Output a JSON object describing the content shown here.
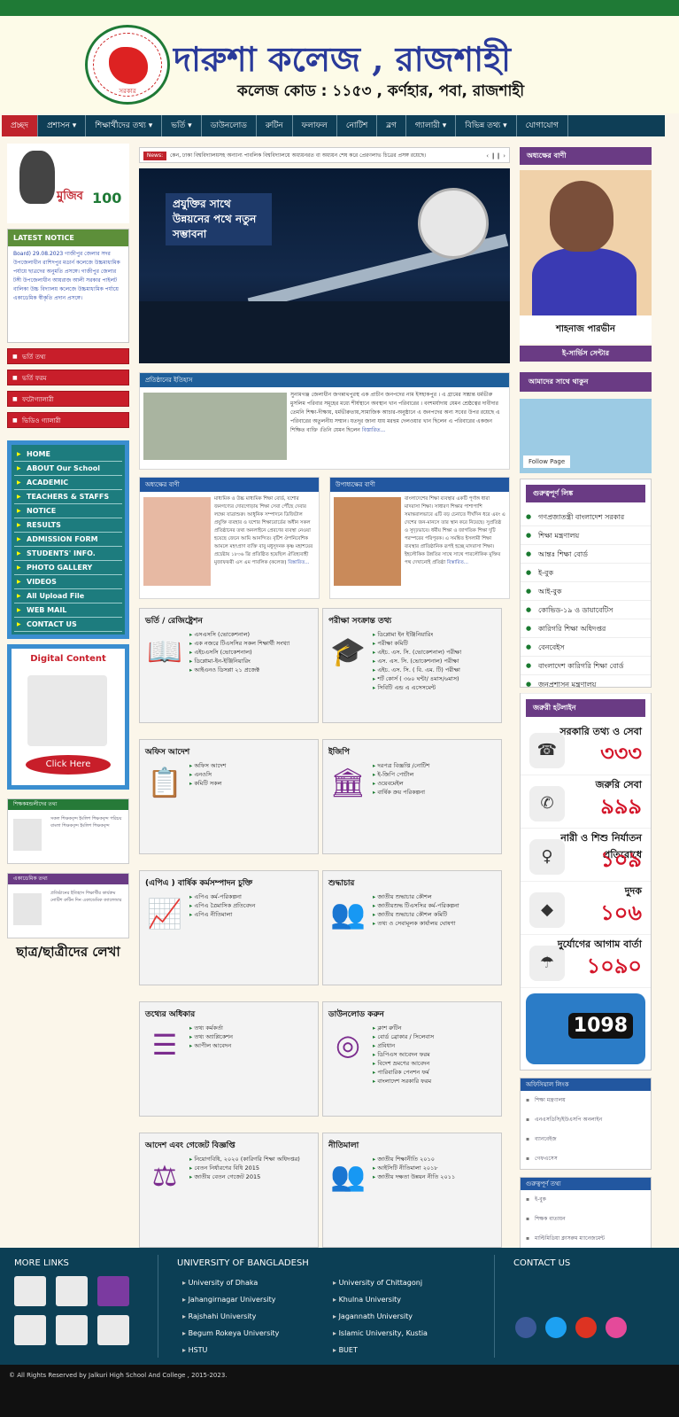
{
  "header": {
    "title": "দারুশা কলেজ , রাজশাহী",
    "subtitle": "কলেজ কোড : ১১৫৩ , কর্ণহার, পবা, রাজশাহী",
    "seal_text": "সরকার"
  },
  "nav": [
    "প্রচ্ছদ",
    "প্রশাসন ▾",
    "শিক্ষার্থীদের তথ্য ▾",
    "ভর্তি ▾",
    "ডাউনলোড",
    "রুটিন",
    "ফলাফল",
    "নোটিশ",
    "ব্লগ",
    "গ্যালারী ▾",
    "বিভিন্ন তথ্য ▾",
    "যোগাযোগ"
  ],
  "left": {
    "mujib_title": "মুজিব",
    "mujib_num": "100",
    "latest_notice_title": "LATEST NOTICE",
    "notice_text": "Board) 29.08.2023 গাজীপুর জেলার সদর উপজেলাধীন রাশিদপুর মডার্ন কলেজে উচ্চমাধ্যমিক পর্যায়ে ছাত্রদের অনুমতি প্রসঙ্গে। গাজীপুর জেলার টঙ্গী উপজেলাধীন আয়রাজ আলী সরকার পাইলট বালিকা উচ্চ বিদ্যালয় কলেজে উচ্চমাধ্যমিক পর্যায়ে একাডেমিক স্বীকৃতি প্রদান প্রসঙ্গে।",
    "red_buttons": [
      "ভর্তি তথ্য",
      "ভর্তি ফরম",
      "ফটোগ্যালারী",
      "ভিডিও গ্যালারী"
    ],
    "menu": [
      "HOME",
      "ABOUT Our School",
      "ACADEMIC",
      "TEACHERS & STAFFS",
      "NOTICE",
      "RESULTS",
      "ADMISSION FORM",
      "STUDENTS' INFO.",
      "PHOTO GALLERY",
      "VIDEOS",
      "All Upload File",
      "WEB MAIL",
      "CONTACT US"
    ],
    "digital_content_title": "Digital Content",
    "click_here": "Click Here",
    "teacher_widget_title": "শিক্ষকমন্ডলীদের তথ্য",
    "teacher_widget_items": "সকল শিক্ষকবৃন্দ ইংলিশ শিক্ষকবৃন্দ পরিচয় বাংলা শিক্ষকবৃন্দ ইংলিশ শিক্ষকবৃন্দ",
    "academic_widget_title": "একাডেমিক তথ্য",
    "academic_widget_items": "প্রতিষ্ঠানের ইতিহাস শিক্ষার্থীর কার্যক্রম নোটিশ রুটিন দিন একাডেমিক ক্যালেন্ডার",
    "students_writing": "ছাত্র/ছাত্রীদের লেখা"
  },
  "middle": {
    "news_label": "News:",
    "news_text": "কেন, ঢাকা বিশ্ববিদ্যালয়সহ অন্যান্য পাবলিক বিশ্ববিদ্যালয়ে অধ্যয়নরত বা অধ্যয়ন শেষ করে প্রেরণলাভ চিত্রের প্রসঙ্গ রয়েছে।",
    "news_controls": "‹ ❙❙ ›",
    "slider_caption": "প্রযুক্তির সাথে উন্নয়নের পথে নতুন সম্ভাবনা",
    "history_title": "প্রতিষ্ঠানের ইতিহাস",
    "history_text": "সুনামগঞ্জ জেলাধীন জগন্নাথপুরস্থ এক প্রাচীন জনপদের নাম ইসহাকপুর । এ গ্রামের সম্ভ্রান্ত ধর্মভীরু মুসলিম পরিবার সমূহের মধ্যে শীর্ষস্থানে অবস্থান খান পরিবারের । বংশমর্যাদায় যেমন শ্রেষ্ঠত্বের দাবীদার তেমনি শিক্ষা-দীক্ষায়, ধর্মভীরুতায়,সামাজিক আচার-অনুষ্ঠানে এ জনপদের অন্য সবের উপর রয়েছে এ পরিবারের অতুলনীয় সম্মান। যতদূর জানা যায় মরহুম দেলওয়ার খান ছিলেন এ পরিবারের একজন শিক্ষিত ব্যক্তি ।তিনি যেমন ছিলেন",
    "read_more": "বিস্তারিত...",
    "principal_title": "অধ্যক্ষের বাণী",
    "principal_text": "মাধ্যমিক ও উচ্চ মাধ্যমিক শিক্ষা বোর্ড, যশোর জনগণ্যের দোরগোড়ায় শিক্ষা সেবা পৌঁছে দেবার লক্ষ্যে যাত্রাশুরু। আধুনিক সম্পাদনে ডিজিটাল প্রযুক্তি ব্যবহার ও যশোর শিক্ষাবোর্ডের অধীন সকল প্রতিষ্ঠানের তথ্য অনলাইনে প্রেরণের ব্যবস্থা নেওয়া হয়েছে জেনে আমি আনন্দিত। বৃটিশ ঔপনিবেশিক আমলে মহৎপ্রাণ ব্যক্তি বাবু মধুসূদনক কৃষ্ণ মহাশয়ের প্রচেষ্টায় ১৮৩৬ খ্রি প্রতিষ্ঠিত হয়েছিল ঐতিহ্যবাহী মুজাফফরী এস এম পাবলিক (কলেজ)",
    "vice_title": "উপাধ্যক্ষের বাণী",
    "vice_text": "বাংলাদেশের শিক্ষা ব্যবস্থার একটি পূর্ণাঙ্গ ধারা মাদরাসা শিক্ষা। সাধারণ শিক্ষার পাশাপাশি সমান্তরালভাবে এটি বড় চেনাতে দীর্ঘদিন ধরে এবং এ দেশের জন-মানসে তার স্থান করে নিয়েছে। সুপ্রতিষ্ঠ ও সুদৃঢ়ভাবে। ধর্মীয় শিক্ষা ও জাগতিক শিক্ষা দুটি পরস্পরের পরিপূরক। এ সমন্বিত ইসলামী শিক্ষা ব্যবস্থার প্রাতিষ্ঠানিক রূপই হচ্ছে মাদরাসা শিক্ষা। ইহলৌকিক উন্নতির সাথে সাথে পারলৌকিক মুক্তির পথ দেখানোই প্রতিষ্ঠা",
    "boxes": [
      {
        "title": "ভর্তি / রেজিষ্ট্রেশন",
        "icon": "book-icon",
        "glyph": "📖",
        "items": [
          "এসএসসি (ভোকেশনাল)",
          "এক নজরে টিএসসির সকল শিক্ষার্থী সংখ্যা",
          "এইচএসসি (ভোকেশনাল)",
          "ডিপ্লোমা-ইন-ইঞ্জিনিয়ারিং",
          "আইএনও ডিসপ্লা ২১ প্রজেক্ট"
        ]
      },
      {
        "title": "পরীক্ষা সংক্রান্ত তথ্য",
        "icon": "graduate-icon",
        "glyph": "🎓",
        "items": [
          "ডিপ্লোমা ইন ইঞ্জিনিয়ারিং",
          "পরীক্ষা কমিটি",
          "এইচ. এস. সি. (ভোকেশনাল) পরীক্ষা",
          "এস. এস. সি. (ভোকেশনাল) পরীক্ষা",
          "এইচ. এস. সি. ( বি. এম. টি) পরীক্ষা",
          "শর্ট কোর্স ( ৩৬০ ঘন্টা/ ৪মাস/৬মাস)",
          "সিবিটি এন্ড এ এসেসমেন্ট"
        ]
      },
      {
        "title": "অফিস আদেশ",
        "icon": "clipboard-icon",
        "glyph": "📋",
        "items": [
          "অফিস আদেশ",
          "এনওসি",
          "কমিটি সকল"
        ]
      },
      {
        "title": "ইজিপি",
        "icon": "egp-icon",
        "glyph": "🏛",
        "items": [
          "দরপত্র বিজ্ঞপ্তি /নোটিশ",
          "ই-জিপি পোর্টাল",
          "ওয়েবমেইল",
          "বার্ষিক ক্রয় পরিকল্পনা"
        ]
      },
      {
        "title": "(এপিএ ) বার্ষিক কর্মসম্পাদন চুক্তি",
        "icon": "growth-chart-icon",
        "glyph": "📈",
        "items": [
          "এপিএ কর্ম-পরিকল্পনা",
          "এপিএ ত্রৈমাসিক প্রতিবেদন",
          "এপিএ নীতিমালা"
        ]
      },
      {
        "title": "শুদ্ধাচার",
        "icon": "people-icon",
        "glyph": "👥",
        "items": [
          "জাতীয় শুদ্ধাচার কৌশল",
          "জাতীয়শুদ্ধ টিএসসির কর্ম-পরিকল্পনা",
          "জাতীয় শুদ্ধাচার কৌশল কমিটি",
          "তথ্য ও সেবামূলক কার্যালয় ঘোষণা"
        ]
      },
      {
        "title": "তথ্যের অধিকার",
        "icon": "info-list-icon",
        "glyph": "☰",
        "items": [
          "তথ্য কর্মকর্তা",
          "তথ্য অ্যাপ্লিকেশন",
          "আপীল আবেদন"
        ]
      },
      {
        "title": "ডাউনলোড করুন",
        "icon": "target-icon",
        "glyph": "◎",
        "items": [
          "ক্লাশ রুটিন",
          "বোর্ড ব্রোকার / সিলেবাস",
          "প্রবিধান",
          "ডিপিএস আবেদন ফরম",
          "বিদেশ ভ্রমণের আবেদন",
          "পারিবারিক পেনশন ফর্ম",
          "বাংলাদেশ সরকারি ফরম"
        ]
      },
      {
        "title": "আদেশ এবং গেজেট বিজ্ঞপ্তি",
        "icon": "scales-icon",
        "glyph": "⚖",
        "items": [
          "নিয়োগবিধি, ২০২০ (কারিগরি শিক্ষা অধিদপ্তর)",
          "বেতন নির্ধারণের বিধি 2015",
          "জাতীয় বেতন গেজেট 2015"
        ]
      },
      {
        "title": "নীতিমালা",
        "icon": "team-icon",
        "glyph": "👥",
        "items": [
          "জাতীয় শিক্ষানীতি ২০১০",
          "আইসিটি নীতিমালা ২০১৮",
          "জাতীয় দক্ষতা উন্নয়ন নীতি ২০১১"
        ]
      }
    ]
  },
  "right": {
    "principal_msg_title": "অধ্যক্ষের বাণী",
    "principal_name": "শাহনাজ পারভীন",
    "eservice": "ই-সার্ভিস সেন্টার",
    "follow_us": "আমাদের সাথে থাকুন",
    "fb_follow": "Follow Page",
    "important_links_title": "গুরুত্বপূর্ণ লিঙ্ক",
    "important_links": [
      "গণপ্রজাতন্ত্রী বাংলাদেশ সরকার",
      "শিক্ষা মন্ত্রণালয়",
      "আন্তঃ শিক্ষা বোর্ড",
      "ই-বুক",
      "আই-বুক",
      "কোভিড-১৯ ও ডায়াবেটিস",
      "কারিগরি শিক্ষা অধিদপ্তর",
      "বেনবেইস",
      "বাংলাদেশ কারিগরি শিক্ষা বোর্ড",
      "জনপ্রশাসন মন্ত্রণালয়"
    ],
    "hotline_title": "জরুরী হটলাইন",
    "hotlines": [
      {
        "label": "সরকারি তথ্য ও সেবা",
        "number": "৩৩৩"
      },
      {
        "label": "জরুরি সেবা",
        "number": "৯৯৯"
      },
      {
        "label": "নারী ও শিশু নির্যাতন প্রতিরোধে",
        "number": "১০৯"
      },
      {
        "label": "দুদক",
        "number": "১০৬"
      },
      {
        "label": "দুর্যোগের আগাম বার্তা",
        "number": "১০৯০"
      }
    ],
    "child_helpline": "1098",
    "official_links_title": "অফিসিয়াল লিংক",
    "official_links": [
      "শিক্ষা মন্ত্রণালয়",
      "এনএসডিসি/ইউএসপি অনলাইন",
      "ব্যানবেইজ",
      "গেফএসেস"
    ],
    "important_info_title": "গুরুত্বপূর্ণ তথ্য",
    "important_info": [
      "ই-বুক",
      "শিক্ষক বাতায়ন",
      "মাল্টিমিডিয়া ক্লাসরুম ম্যানেজমেন্ট"
    ]
  },
  "footer": {
    "more_links": "MORE LINKS",
    "university_title": "UNIVERSITY OF BANGLADESH",
    "contact": "CONTACT US",
    "universities_left": [
      "University of Dhaka",
      "Jahangirnagar University",
      "Rajshahi University",
      "Begum Rokeya University",
      "HSTU"
    ],
    "universities_right": [
      "University of Chittagonj",
      "Khulna University",
      "Jagannath University",
      "Islamic University, Kustia",
      "BUET"
    ],
    "copyright": "© All Rights Reserved by Jalkuri High School And College , 2015-2023."
  },
  "colors": {
    "nav": "#0e3e56",
    "accent": "#6a3b84",
    "red": "#c81e2a",
    "green": "#1f7a36",
    "footer": "#0c3f55"
  }
}
